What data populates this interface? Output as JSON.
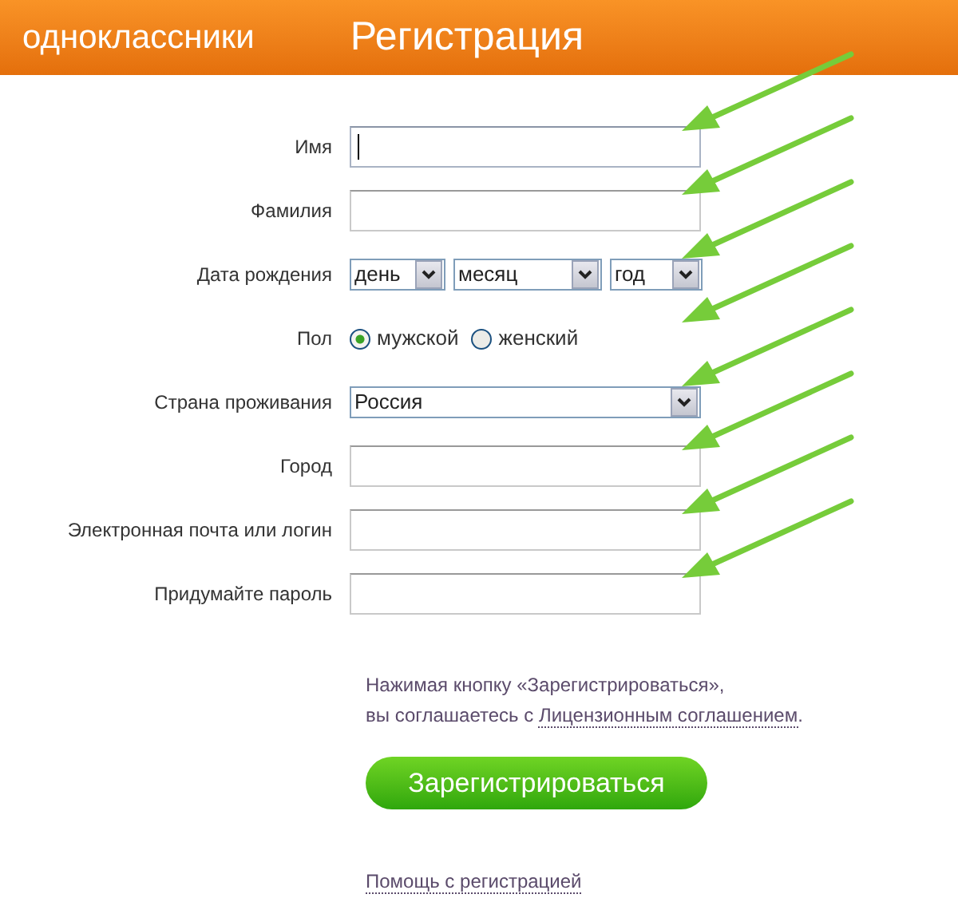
{
  "header": {
    "logo": "одноклассники",
    "title": "Регистрация"
  },
  "fields": [
    {
      "kind": "text",
      "label": "Имя",
      "focused": true
    },
    {
      "kind": "text",
      "label": "Фамилия",
      "focused": false
    },
    {
      "kind": "date",
      "label": "Дата рождения",
      "selects": [
        "день",
        "месяц",
        "год"
      ]
    },
    {
      "kind": "radio",
      "label": "Пол",
      "options": [
        {
          "label": "мужской",
          "selected": true
        },
        {
          "label": "женский",
          "selected": false
        }
      ]
    },
    {
      "kind": "select",
      "label": "Страна проживания",
      "value": "Россия"
    },
    {
      "kind": "text",
      "label": "Город",
      "focused": false
    },
    {
      "kind": "text",
      "label": "Электронная почта или логин",
      "focused": false
    },
    {
      "kind": "text",
      "label": "Придумайте пароль",
      "focused": false
    }
  ],
  "agreement": {
    "line_1": "Нажимая кнопку «Зарегистрироваться»,",
    "line_2": "вы соглашаетесь с ",
    "link": "Лицензионным соглашением",
    "end": "."
  },
  "submit_button": "Зарегистрироваться",
  "help_link": "Помощь с регистрацией"
}
